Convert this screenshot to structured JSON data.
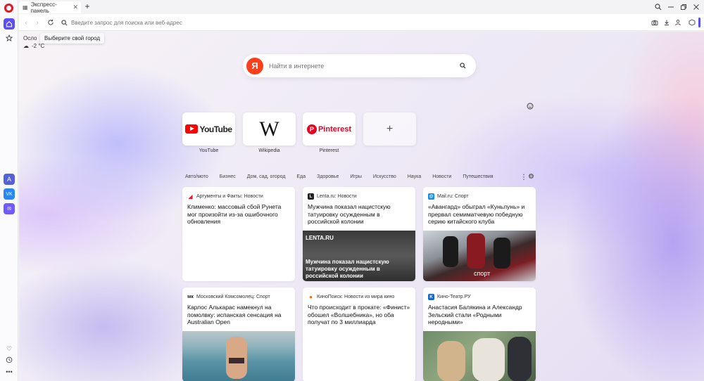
{
  "tab": {
    "title": "Экспресс-панель"
  },
  "address": {
    "placeholder": "Введите запрос для поиска или веб-адрес"
  },
  "weather": {
    "city": "Осло",
    "tooltip": "Выберите свой город",
    "temp": "-2 °C"
  },
  "search": {
    "placeholder": "Найти в интернете",
    "logo": "Я"
  },
  "speed_dial": [
    {
      "label": "YouTube",
      "logo": "YouTube"
    },
    {
      "label": "Wikipedia",
      "logo": "W"
    },
    {
      "label": "Pinterest",
      "logo": "Pinterest"
    },
    {
      "label": "",
      "logo": "+"
    }
  ],
  "categories": [
    "Авто/мото",
    "Бизнес",
    "Дом, сад, огород",
    "Еда",
    "Здоровье",
    "Игры",
    "Искусство",
    "Наука",
    "Новости",
    "Путешествия"
  ],
  "news": [
    {
      "source": "Аргументы и Факты: Новости",
      "title": "Клименко: массовый сбой Рунета мог произойти из-за ошибочного обновления"
    },
    {
      "source": "Lenta.ru: Новости",
      "title": "Мужчина показал нацистскую татуировку осужденным в российской колонии",
      "image_brand": "LENTA.RU",
      "image_caption": "Мужчина показал нацистскую татуировку осужденным в российской колонии"
    },
    {
      "source": "Mail.ru: Спорт",
      "title": "«Авангард» обыграл «Куньлунь» и прервал семиматчевую победную серию китайского клуба",
      "image_brand": "спорт"
    },
    {
      "source": "Московский Комсомолец: Спорт",
      "title": "Карлос Алькарас намекнул на помолвку: испанская сенсация на Australian Open"
    },
    {
      "source": "КиноПоиск: Новости из мира кино",
      "title": "Что происходит в прокате: «Финист» обошел «Волшебника», но оба получат по 3 миллиарда"
    },
    {
      "source": "Кино-Театр.РУ",
      "title": "Анастасия Балякина и Александр Зельский стали «Родными неродными»"
    }
  ]
}
